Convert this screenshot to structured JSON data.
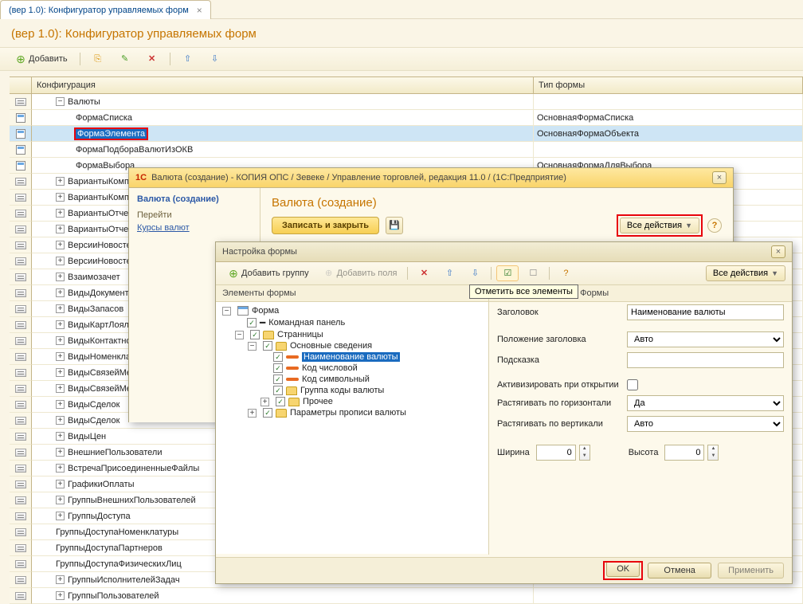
{
  "tab": {
    "label": "(вер 1.0): Конфигуратор управляемых форм"
  },
  "page_title": "(вер 1.0): Конфигуратор управляемых форм",
  "toolbar": {
    "add": "Добавить"
  },
  "columns": {
    "conf": "Конфигурация",
    "type": "Тип формы"
  },
  "rows": [
    {
      "level": 1,
      "name": "Валюты",
      "type": "",
      "kind": "cat",
      "expand": "-"
    },
    {
      "level": 2,
      "name": "ФормаСписка",
      "type": "ОсновнаяФормаСписка",
      "kind": "form"
    },
    {
      "level": 2,
      "name": "ФормаЭлемента",
      "type": "ОсновнаяФормаОбъекта",
      "kind": "form",
      "sel": true,
      "red": true
    },
    {
      "level": 2,
      "name": "ФормаПодбораВалютИзОКВ",
      "type": "",
      "kind": "form"
    },
    {
      "level": 2,
      "name": "ФормаВыбора",
      "type": "ОсновнаяФормаДляВыбора",
      "kind": "form"
    },
    {
      "level": 1,
      "name": "ВариантыКомплектацииНоменклатуры",
      "type": "",
      "kind": "cat",
      "expand": "+"
    },
    {
      "level": 1,
      "name": "ВариантыКомплектацииНоменклатуры",
      "type": "",
      "kind": "cat",
      "expand": "+"
    },
    {
      "level": 1,
      "name": "ВариантыОтчетов",
      "type": "",
      "kind": "cat",
      "expand": "+"
    },
    {
      "level": 1,
      "name": "ВариантыОтчетов",
      "type": "",
      "kind": "cat",
      "expand": "+"
    },
    {
      "level": 1,
      "name": "ВерсииНовостей",
      "type": "",
      "kind": "cat",
      "expand": "+"
    },
    {
      "level": 1,
      "name": "ВерсииНовостей",
      "type": "",
      "kind": "cat",
      "expand": "+"
    },
    {
      "level": 1,
      "name": "Взаимозачет",
      "type": "",
      "kind": "cat",
      "expand": "+"
    },
    {
      "level": 1,
      "name": "ВидыДокументов",
      "type": "",
      "kind": "cat",
      "expand": "+"
    },
    {
      "level": 1,
      "name": "ВидыЗапасов",
      "type": "",
      "kind": "cat",
      "expand": "+"
    },
    {
      "level": 1,
      "name": "ВидыКартЛояльности",
      "type": "",
      "kind": "cat",
      "expand": "+"
    },
    {
      "level": 1,
      "name": "ВидыКонтактной",
      "type": "",
      "kind": "cat",
      "expand": "+"
    },
    {
      "level": 1,
      "name": "ВидыНоменклатуры",
      "type": "",
      "kind": "cat",
      "expand": "+"
    },
    {
      "level": 1,
      "name": "ВидыСвязейМеждуДоку",
      "type": "",
      "kind": "cat",
      "expand": "+"
    },
    {
      "level": 1,
      "name": "ВидыСвязейМеждуДоку",
      "type": "",
      "kind": "cat",
      "expand": "+"
    },
    {
      "level": 1,
      "name": "ВидыСделок",
      "type": "",
      "kind": "cat",
      "expand": "+"
    },
    {
      "level": 1,
      "name": "ВидыСделок",
      "type": "",
      "kind": "cat",
      "expand": "+"
    },
    {
      "level": 1,
      "name": "ВидыЦен",
      "type": "",
      "kind": "cat",
      "expand": "+"
    },
    {
      "level": 1,
      "name": "ВнешниеПользователи",
      "type": "",
      "kind": "cat",
      "expand": "+"
    },
    {
      "level": 1,
      "name": "ВстречаПрисоединенныеФайлы",
      "type": "",
      "kind": "cat",
      "expand": "+"
    },
    {
      "level": 1,
      "name": "ГрафикиОплаты",
      "type": "",
      "kind": "cat",
      "expand": "+"
    },
    {
      "level": 1,
      "name": "ГруппыВнешнихПользователей",
      "type": "",
      "kind": "cat",
      "expand": "+"
    },
    {
      "level": 1,
      "name": "ГруппыДоступа",
      "type": "",
      "kind": "cat",
      "expand": "+"
    },
    {
      "level": 1,
      "name": "ГруппыДоступаНоменклатуры",
      "type": "",
      "kind": "cat"
    },
    {
      "level": 1,
      "name": "ГруппыДоступаПартнеров",
      "type": "",
      "kind": "cat"
    },
    {
      "level": 1,
      "name": "ГруппыДоступаФизическихЛиц",
      "type": "",
      "kind": "cat"
    },
    {
      "level": 1,
      "name": "ГруппыИсполнителейЗадач",
      "type": "",
      "kind": "cat",
      "expand": "+"
    },
    {
      "level": 1,
      "name": "ГруппыПользователей",
      "type": "",
      "kind": "cat",
      "expand": "+"
    }
  ],
  "editor": {
    "title": "Валюта (создание) - КОПИЯ ОПС / Зевеке / Управление торговлей, редакция 11.0 /  (1С:Предприятие)",
    "sidebar_heading": "Валюта (создание)",
    "sidebar_goto": "Перейти",
    "sidebar_link": "Курсы валют",
    "main_title": "Валюта (создание)",
    "save_close": "Записать и закрыть",
    "all_actions": "Все действия"
  },
  "settings": {
    "title": "Настройка формы",
    "add_group": "Добавить группу",
    "add_fields": "Добавить поля",
    "all_actions": "Все действия",
    "left_head": "Элементы формы",
    "right_head": "та Формы",
    "tooltip": "Отметить все элементы",
    "tree": {
      "root": "Форма",
      "command_panel": "Командная панель",
      "pages": "Странницы",
      "main_info": "Основные сведения",
      "field_name": "Наименование валюты",
      "field_numcode": "Код числовой",
      "field_symcode": "Код символьный",
      "group_codes": "Группа коды валюты",
      "other": "Прочее",
      "params": "Параметры прописи валюты"
    },
    "props": {
      "label_title": "Заголовок",
      "val_title": "Наименование валюты",
      "label_title_pos": "Положение заголовка",
      "val_title_pos": "Авто",
      "label_hint": "Подсказка",
      "label_activate": "Активизировать при открытии",
      "label_hstretch": "Растягивать по горизонтали",
      "val_hstretch": "Да",
      "label_vstretch": "Растягивать по вертикали",
      "val_vstretch": "Авто",
      "label_width": "Ширина",
      "val_width": "0",
      "label_height": "Высота",
      "val_height": "0"
    },
    "btn_ok": "OK",
    "btn_cancel": "Отмена",
    "btn_apply": "Применить"
  }
}
